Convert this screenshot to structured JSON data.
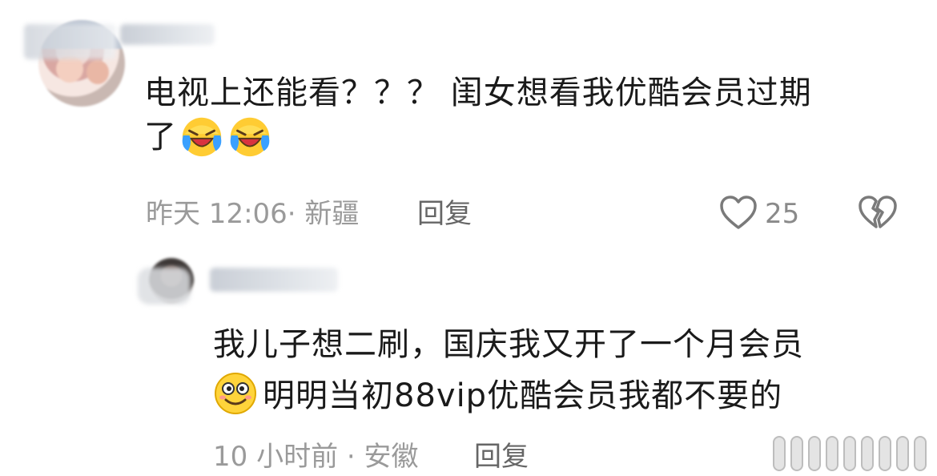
{
  "comments": [
    {
      "text_line1": "电视上还能看？？？ 闺女想看我优酷会员过期",
      "text_line2": "了",
      "emojis": [
        "crying-laughing-emoji",
        "crying-laughing-emoji"
      ],
      "meta": "昨天 12:06· 新疆",
      "reply_label": "回复",
      "like_count": "25",
      "icons": {
        "like": "heart-icon",
        "dislike": "broken-heart-icon"
      }
    },
    {
      "text_line1": "我儿子想二刷，国庆我又开了一个月会员",
      "text_line2": "明明当初88vip优酷会员我都不要的",
      "emojis": [
        "silly-smile-emoji"
      ],
      "meta": "10 小时前 · 安徽",
      "reply_label": "回复"
    }
  ],
  "colors": {
    "text": "#1a1a1a",
    "meta": "#9a9a9a",
    "reply": "#666666",
    "like_count": "#8a8a8a",
    "icon_stroke": "#7a7a7a"
  }
}
